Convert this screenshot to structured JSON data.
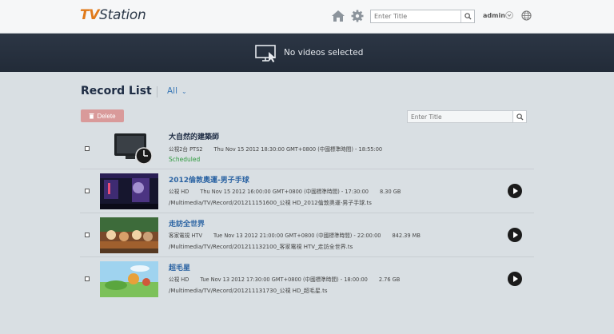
{
  "app": {
    "logo_tv": "TV",
    "logo_station": "Station"
  },
  "header": {
    "search_placeholder": "Enter Title",
    "user": "admin",
    "icons": [
      "home-icon",
      "gear-icon",
      "search-icon",
      "chevron-down-icon",
      "globe-icon"
    ]
  },
  "banner": {
    "message": "No videos selected",
    "icon": "monitor-cursor-icon"
  },
  "list": {
    "title": "Record List",
    "filter": "All",
    "delete_label": "Delete",
    "search_placeholder": "Enter Title"
  },
  "records": [
    {
      "title": "大自然的建築師",
      "channel": "公視2台 PTS2",
      "datetime": "Thu Nov 15 2012 18:30:00 GMT+0800 (中國標準時間) - 18:55:00",
      "status": "Scheduled",
      "thumbnail": "tv-clock-icon"
    },
    {
      "title": "2012倫敦奧運-男子手球",
      "channel": "公視 HD",
      "datetime": "Thu Nov 15 2012 16:00:00 GMT+0800 (中國標準時間) - 17:30:00",
      "size": "8.30 GB",
      "path": "/Multimedia/TV/Record/201211151600_公視 HD_2012倫敦奧運-男子手球.ts"
    },
    {
      "title": "走訪全世界",
      "channel": "客家電視 HTV",
      "datetime": "Tue Nov 13 2012 21:00:00 GMT+0800 (中國標準時間) - 22:00:00",
      "size": "842.39 MB",
      "path": "/Multimedia/TV/Record/201211132100_客家電視 HTV_走訪全世界.ts"
    },
    {
      "title": "超毛星",
      "channel": "公視 HD",
      "datetime": "Tue Nov 13 2012 17:30:00 GMT+0800 (中國標準時間) - 18:00:00",
      "size": "2.76 GB",
      "path": "/Multimedia/TV/Record/201211131730_公視 HD_超毛星.ts"
    }
  ],
  "colors": {
    "accent": "#e07a1a",
    "banner": "#262f3d",
    "link": "#2c64a3",
    "scheduled": "#2f9a3e",
    "delete": "#d99a9a"
  }
}
